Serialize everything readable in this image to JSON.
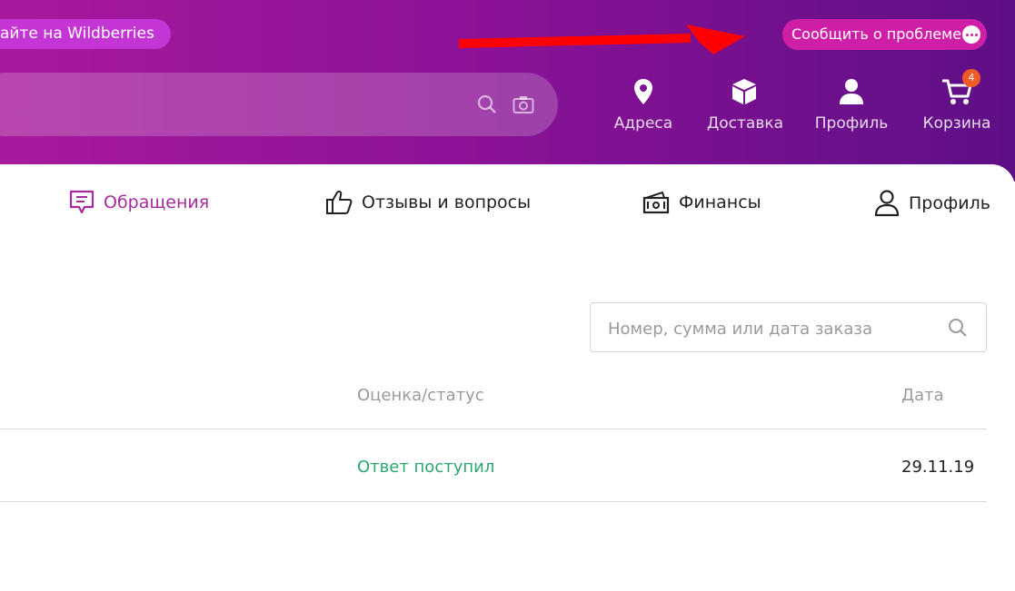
{
  "header": {
    "promo_text": "айте на Wildberries",
    "report_button": "Сообщить о проблеме",
    "nav": [
      {
        "label": "Адреса",
        "icon": "location-pin-icon"
      },
      {
        "label": "Доставка",
        "icon": "box-icon"
      },
      {
        "label": "Профиль",
        "icon": "user-icon"
      },
      {
        "label": "Корзина",
        "icon": "cart-icon"
      }
    ],
    "cart_count": "4"
  },
  "tabs": [
    {
      "label": "Обращения",
      "icon": "message-icon",
      "active": true
    },
    {
      "label": "Отзывы и вопросы",
      "icon": "thumbs-up-icon",
      "active": false
    },
    {
      "label": "Финансы",
      "icon": "wallet-icon",
      "active": false
    },
    {
      "label": "Профиль",
      "icon": "user-icon",
      "active": false
    }
  ],
  "order_search": {
    "placeholder": "Номер, сумма или дата заказа"
  },
  "table": {
    "columns": [
      "Оценка/статус",
      "Дата"
    ],
    "rows": [
      {
        "status": "Ответ поступил",
        "date": "29.11.19"
      }
    ]
  },
  "colors": {
    "header_start": "#a81a9d",
    "header_end": "#5e0f86",
    "accent": "#a42c9d",
    "status_green": "#2da66e",
    "report_pill": "#cf1fa7",
    "badge": "#f05a28"
  }
}
